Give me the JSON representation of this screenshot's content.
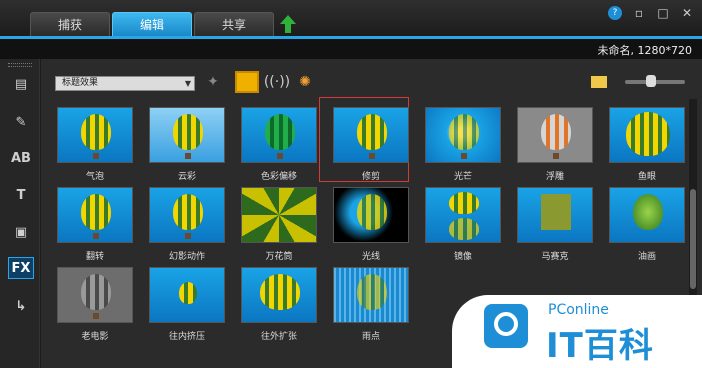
{
  "tabs": [
    {
      "label": "捕获"
    },
    {
      "label": "编辑"
    },
    {
      "label": "共享"
    }
  ],
  "window": {
    "help": "?",
    "min": "▫",
    "max": "□",
    "close": "✕"
  },
  "project": {
    "title": "未命名, 1280*720"
  },
  "toolbar": {
    "category": "标题效果"
  },
  "effects": [
    {
      "label": "气泡"
    },
    {
      "label": "云彩"
    },
    {
      "label": "色彩偏移"
    },
    {
      "label": "修剪"
    },
    {
      "label": "光芒"
    },
    {
      "label": "浮雕"
    },
    {
      "label": "鱼眼"
    },
    {
      "label": "翻转"
    },
    {
      "label": "幻影动作"
    },
    {
      "label": "万花筒"
    },
    {
      "label": "光线"
    },
    {
      "label": "镜像"
    },
    {
      "label": "马赛克"
    },
    {
      "label": "油画"
    },
    {
      "label": "老电影"
    },
    {
      "label": "往内挤压"
    },
    {
      "label": "往外扩张"
    },
    {
      "label": "雨点"
    }
  ],
  "watermark": {
    "small": "PConline",
    "big": "IT百科"
  },
  "colors": {
    "accent": "#2aa6e6",
    "selection": "#d53a3a",
    "brand": "#1e8fd6"
  }
}
